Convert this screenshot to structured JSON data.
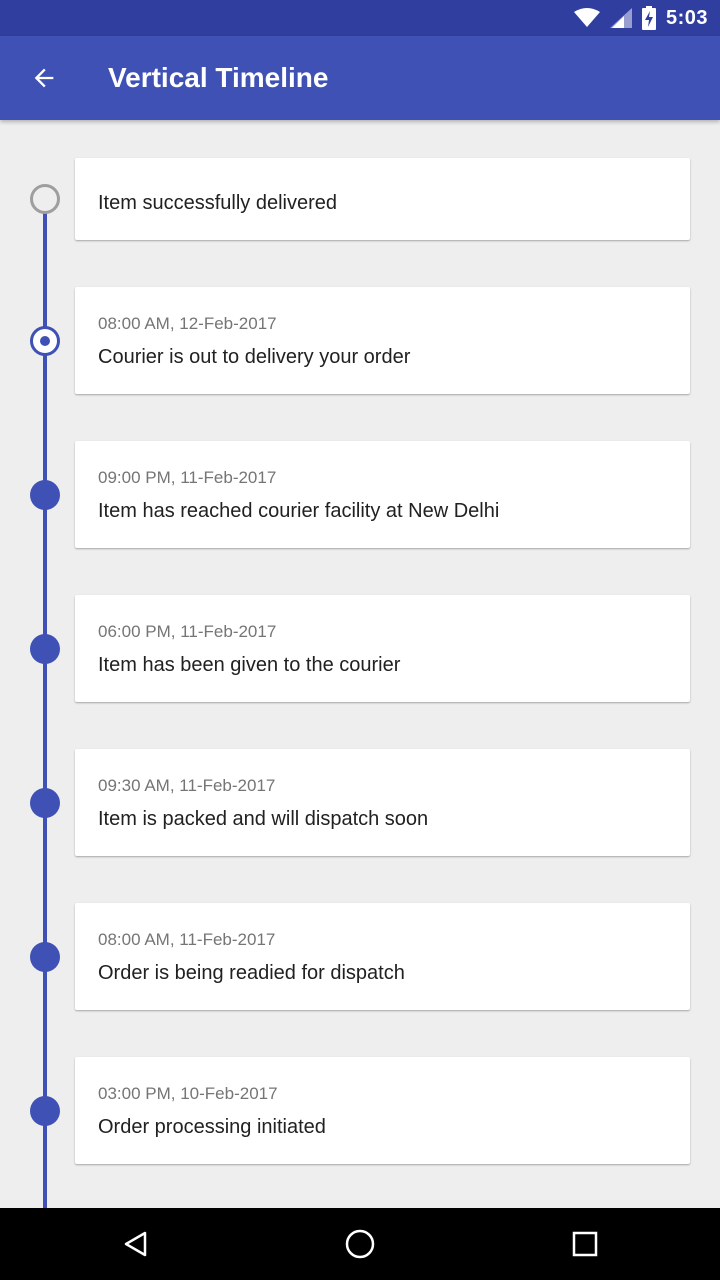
{
  "status_bar": {
    "time": "5:03",
    "icons": [
      "wifi-icon",
      "signal-icon",
      "battery-charging-icon"
    ]
  },
  "app_bar": {
    "title": "Vertical Timeline",
    "back_icon": "arrow-back-icon"
  },
  "timeline": {
    "line_color": "#3f51b5",
    "events": [
      {
        "time": "",
        "message": "Item successfully delivered",
        "state": "pending"
      },
      {
        "time": "08:00 AM, 12-Feb-2017",
        "message": "Courier is out to delivery your order",
        "state": "active"
      },
      {
        "time": "09:00 PM, 11-Feb-2017",
        "message": "Item has reached courier facility at New Delhi",
        "state": "completed"
      },
      {
        "time": "06:00 PM, 11-Feb-2017",
        "message": "Item has been given to the courier",
        "state": "completed"
      },
      {
        "time": "09:30 AM, 11-Feb-2017",
        "message": "Item is packed and will dispatch soon",
        "state": "completed"
      },
      {
        "time": "08:00 AM, 11-Feb-2017",
        "message": "Order is being readied for dispatch",
        "state": "completed"
      },
      {
        "time": "03:00 PM, 10-Feb-2017",
        "message": "Order processing initiated",
        "state": "completed"
      }
    ]
  },
  "colors": {
    "primary": "#3f51b5",
    "primary_dark": "#303f9f",
    "pending": "#9e9e9e"
  },
  "nav_bar": {
    "buttons": [
      "back-triangle-icon",
      "home-circle-icon",
      "recents-square-icon"
    ]
  }
}
